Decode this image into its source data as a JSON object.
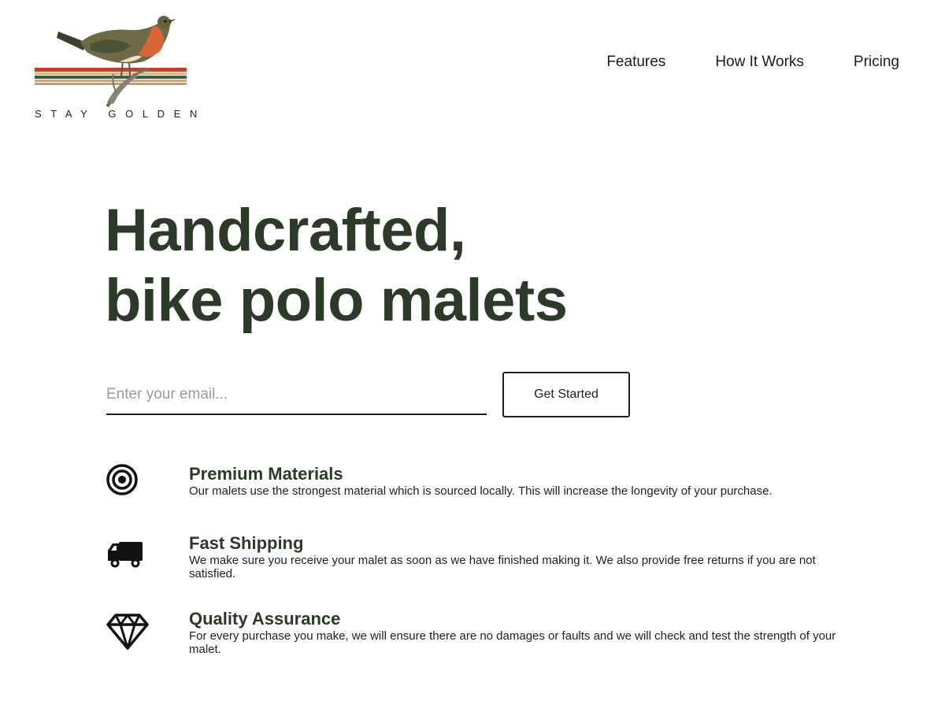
{
  "brand": {
    "tagline": "STAY GOLDEN",
    "logo_icon": "robin-bird-on-branch",
    "stripe_colors": [
      "#b5462a",
      "#d8b48a",
      "#3f5a45",
      "#d6a36b",
      "#c89a65"
    ]
  },
  "nav": {
    "items": [
      {
        "label": "Features"
      },
      {
        "label": "How It Works"
      },
      {
        "label": "Pricing"
      }
    ]
  },
  "hero": {
    "title_line1": "Handcrafted,",
    "title_line2": "bike polo malets"
  },
  "signup": {
    "email_placeholder": "Enter your email...",
    "email_value": "",
    "button_label": "Get Started"
  },
  "features": [
    {
      "icon": "target-icon",
      "title": "Premium Materials",
      "description": "Our malets use the strongest material which is sourced locally. This will increase the longevity of your purchase."
    },
    {
      "icon": "truck-icon",
      "title": "Fast Shipping",
      "description": "We make sure you receive your malet as soon as we have finished making it. We also provide free returns if you are not satisfied."
    },
    {
      "icon": "diamond-icon",
      "title": "Quality Assurance",
      "description": "For every purchase you make, we will ensure there are no damages or faults and we will check and test the strength of your malet."
    }
  ],
  "colors": {
    "heading": "#2c3a28",
    "text": "#1f1f1f",
    "background": "#ffffff"
  }
}
